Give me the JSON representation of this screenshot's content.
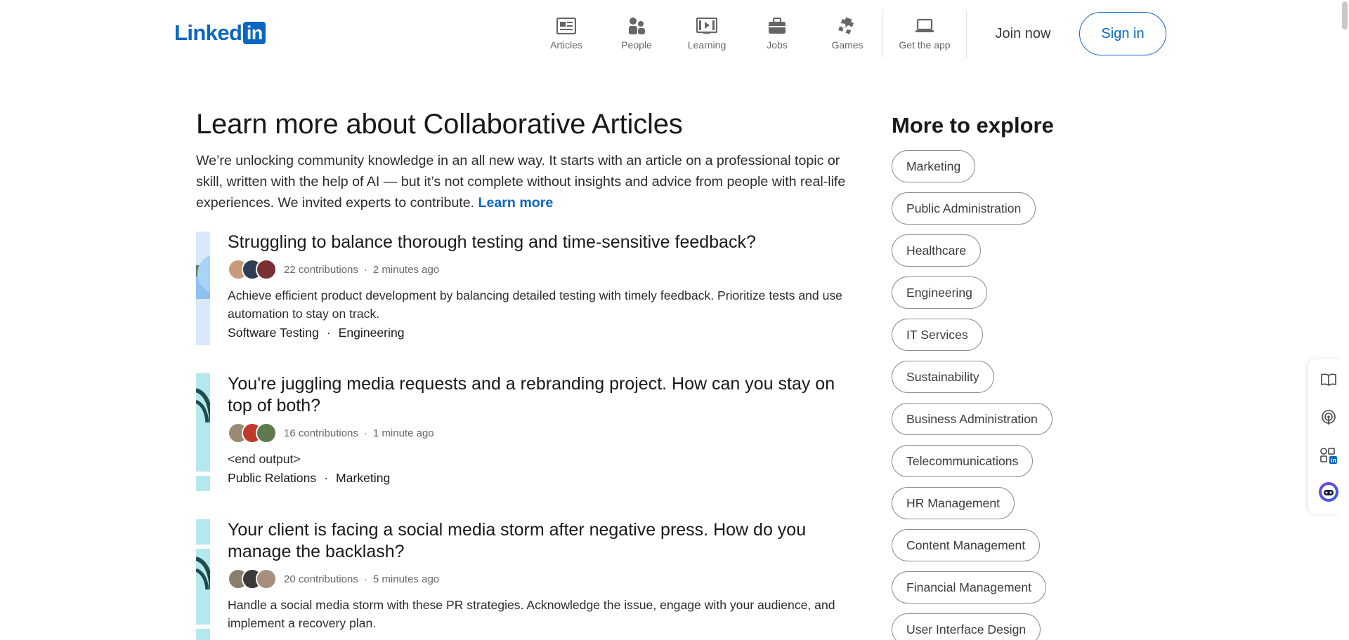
{
  "header": {
    "logo_text": "Linked",
    "logo_box": "in",
    "nav": [
      {
        "label": "Articles",
        "icon": "articles-icon"
      },
      {
        "label": "People",
        "icon": "people-icon"
      },
      {
        "label": "Learning",
        "icon": "learning-icon"
      },
      {
        "label": "Jobs",
        "icon": "jobs-icon"
      },
      {
        "label": "Games",
        "icon": "games-icon"
      },
      {
        "label": "Get the app",
        "icon": "laptop-icon"
      }
    ],
    "join_label": "Join now",
    "signin_label": "Sign in"
  },
  "main": {
    "title": "Learn more about Collaborative Articles",
    "intro": "We’re unlocking community knowledge in an all new way. It starts with an article on a professional topic or skill, written with the help of AI — but it’s not complete without insights and advice from people with real-life experiences. We invited experts to contribute.",
    "learn_more": "Learn more",
    "meta_separator": "·",
    "tag_separator": "·",
    "articles": [
      {
        "title": "Struggling to balance thorough testing and time-sensitive feedback?",
        "contributions": "22 contributions",
        "time": "2 minutes ago",
        "summary": "Achieve efficient product development by balancing detailed testing with timely feedback. Prioritize tests and use automation to stay on track.",
        "tags": [
          "Software Testing",
          "Engineering"
        ]
      },
      {
        "title": "You're juggling media requests and a rebranding project. How can you stay on top of both?",
        "contributions": "16 contributions",
        "time": "1 minute ago",
        "summary": "<end output>",
        "tags": [
          "Public Relations",
          "Marketing"
        ]
      },
      {
        "title": "Your client is facing a social media storm after negative press. How do you manage the backlash?",
        "contributions": "20 contributions",
        "time": "5 minutes ago",
        "summary": "Handle a social media storm with these PR strategies. Acknowledge the issue, engage with your audience, and implement a recovery plan.",
        "tags": []
      }
    ]
  },
  "explore": {
    "title": "More to explore",
    "topics": [
      "Marketing",
      "Public Administration",
      "Healthcare",
      "Engineering",
      "IT Services",
      "Sustainability",
      "Business Administration",
      "Telecommunications",
      "HR Management",
      "Content Management",
      "Financial Management",
      "User Interface Design"
    ]
  },
  "rail": {
    "icons": [
      "book-icon",
      "podcast-icon",
      "linkedin-apps-icon",
      "copilot-icon"
    ]
  },
  "colors": {
    "brand": "#0a66c2",
    "text": "#191919",
    "muted": "#666666",
    "pill_border": "#8c8c8c"
  }
}
